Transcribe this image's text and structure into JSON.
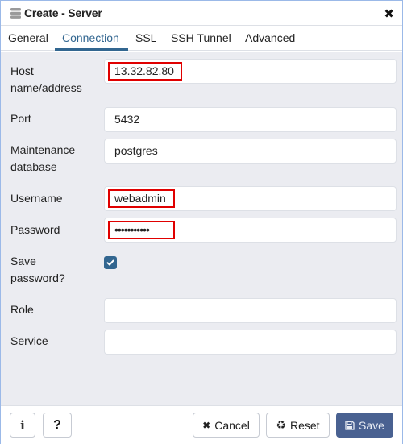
{
  "window": {
    "title": "Create - Server",
    "title_icon": "server-icon",
    "close_icon": "close-icon"
  },
  "tabs": [
    {
      "label": "General",
      "active": false
    },
    {
      "label": "Connection",
      "active": true
    },
    {
      "label": "SSL",
      "active": false
    },
    {
      "label": "SSH Tunnel",
      "active": false
    },
    {
      "label": "Advanced",
      "active": false
    }
  ],
  "form": {
    "host": {
      "label_line1": "Host",
      "label_line2": "name/address",
      "value": "13.32.82.80",
      "highlighted": true
    },
    "port": {
      "label": "Port",
      "value": "5432"
    },
    "maintenance_db": {
      "label_line1": "Maintenance",
      "label_line2": "database",
      "value": "postgres"
    },
    "username": {
      "label": "Username",
      "value": "webadmin",
      "highlighted": true
    },
    "password": {
      "label": "Password",
      "value": "•••••••••••",
      "highlighted": true
    },
    "save_password": {
      "label_line1": "Save",
      "label_line2": "password?",
      "checked": true
    },
    "role": {
      "label": "Role",
      "value": ""
    },
    "service": {
      "label": "Service",
      "value": ""
    }
  },
  "footer": {
    "info_icon": "i",
    "help_icon": "?",
    "cancel_icon": "✖",
    "cancel_label": "Cancel",
    "reset_icon": "♻",
    "reset_label": "Reset",
    "save_label": "Save"
  },
  "colors": {
    "accent": "#326690",
    "primary_button": "#496191",
    "highlight": "#e00000",
    "body_bg": "#ebecf1"
  }
}
